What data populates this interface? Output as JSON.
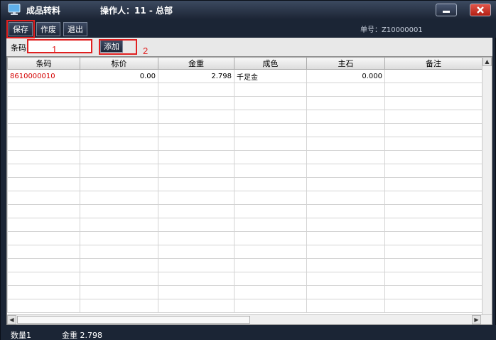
{
  "window": {
    "title": "成品转料",
    "operator": "操作人：11 - 总部",
    "minimize_icon": "minimize-icon",
    "close_icon": "close-icon",
    "app_icon": "monitor-icon"
  },
  "toolbar": {
    "save_label": "保存",
    "void_label": "作废",
    "exit_label": "退出",
    "order_no": "单号：Z10000001"
  },
  "filter": {
    "barcode_label": "条码",
    "barcode_value": "",
    "add_label": "添加"
  },
  "annotations": {
    "marker_1": "1",
    "marker_2": "2",
    "color": "#e02020"
  },
  "table": {
    "columns": [
      "条码",
      "标价",
      "金重",
      "成色",
      "主石",
      "备注"
    ],
    "rows": [
      {
        "barcode": "8610000010",
        "price": "0.00",
        "gold_weight": "2.798",
        "fineness": "千足金",
        "main_stone": "0.000",
        "note": ""
      }
    ],
    "empty_rows": 17
  },
  "status": {
    "quantity": "数量1",
    "gold_weight": "金重 2.798"
  },
  "colors": {
    "window_bg": "#1b2535",
    "barcode_text": "#d40000"
  }
}
